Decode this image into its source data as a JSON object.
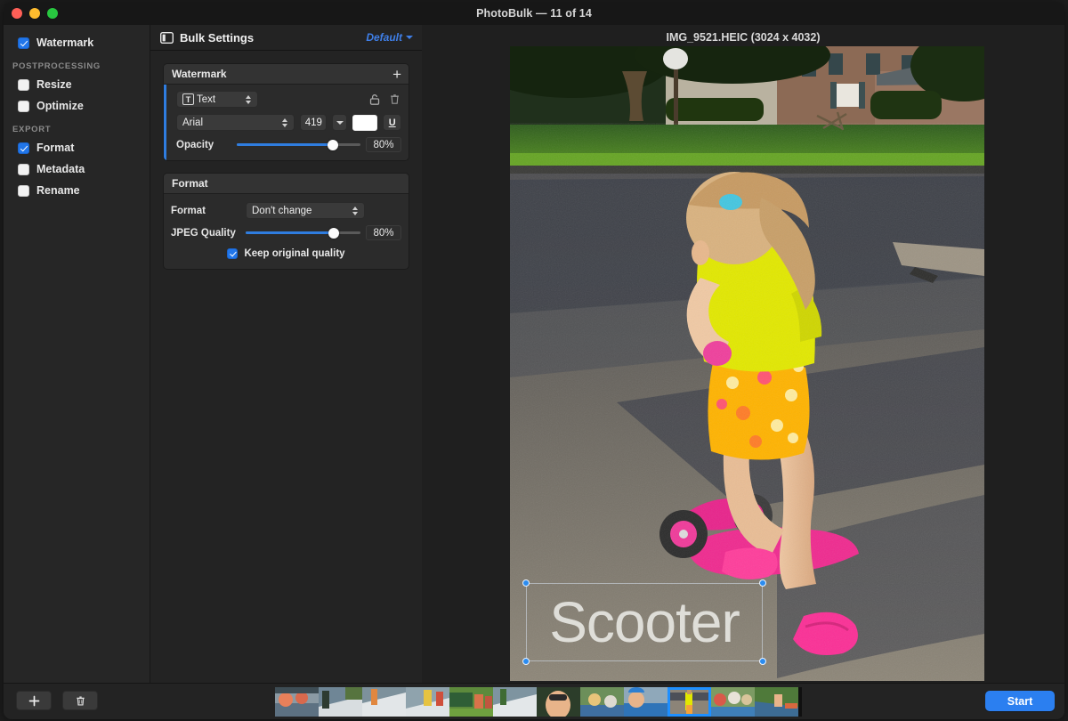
{
  "window": {
    "title": "PhotoBulk — 11 of 14",
    "traffic_lights": [
      "close",
      "minimize",
      "zoom"
    ]
  },
  "sidebar": {
    "items": [
      {
        "label": "Watermark",
        "checked": true
      }
    ],
    "groups": [
      {
        "header": "POSTPROCESSING",
        "items": [
          {
            "label": "Resize",
            "checked": false
          },
          {
            "label": "Optimize",
            "checked": false
          }
        ]
      },
      {
        "header": "EXPORT",
        "items": [
          {
            "label": "Format",
            "checked": true
          },
          {
            "label": "Metadata",
            "checked": false
          },
          {
            "label": "Rename",
            "checked": false
          }
        ]
      }
    ]
  },
  "settings": {
    "title": "Bulk Settings",
    "preset_label": "Default",
    "watermark_card": {
      "header": "Watermark",
      "add_label": "+",
      "type_badge": "T",
      "type_value": "Text",
      "lock_icon": "unlock-icon",
      "delete_icon": "trash-icon",
      "font_value": "Arial",
      "font_size": "419",
      "color_hex": "#ffffff",
      "underline_label": "U",
      "opacity_label": "Opacity",
      "opacity_value": "80%",
      "opacity_percent": 80
    },
    "format_card": {
      "header": "Format",
      "format_label": "Format",
      "format_value": "Don't change",
      "quality_label": "JPEG Quality",
      "quality_value": "80%",
      "quality_percent": 80,
      "keep_original_label": "Keep original quality",
      "keep_original_checked": true
    }
  },
  "preview": {
    "caption": "IMG_9521.HEIC (3024 x 4032)",
    "watermark_text": "Scooter"
  },
  "bottom": {
    "add_label": "+",
    "delete_icon": "trash-icon",
    "start_label": "Start",
    "thumbnails": [
      {
        "index": 1,
        "selected": false
      },
      {
        "index": 2,
        "selected": false
      },
      {
        "index": 3,
        "selected": false
      },
      {
        "index": 4,
        "selected": false
      },
      {
        "index": 5,
        "selected": false
      },
      {
        "index": 6,
        "selected": false
      },
      {
        "index": 7,
        "selected": false
      },
      {
        "index": 8,
        "selected": false
      },
      {
        "index": 9,
        "selected": false
      },
      {
        "index": 10,
        "selected": false
      },
      {
        "index": 11,
        "selected": true
      },
      {
        "index": 12,
        "selected": false
      }
    ]
  },
  "colors": {
    "accent_blue": "#2b7ff0",
    "selection_blue": "#1e8fff",
    "panel_bg": "#232323",
    "sidebar_bg": "#262626"
  }
}
